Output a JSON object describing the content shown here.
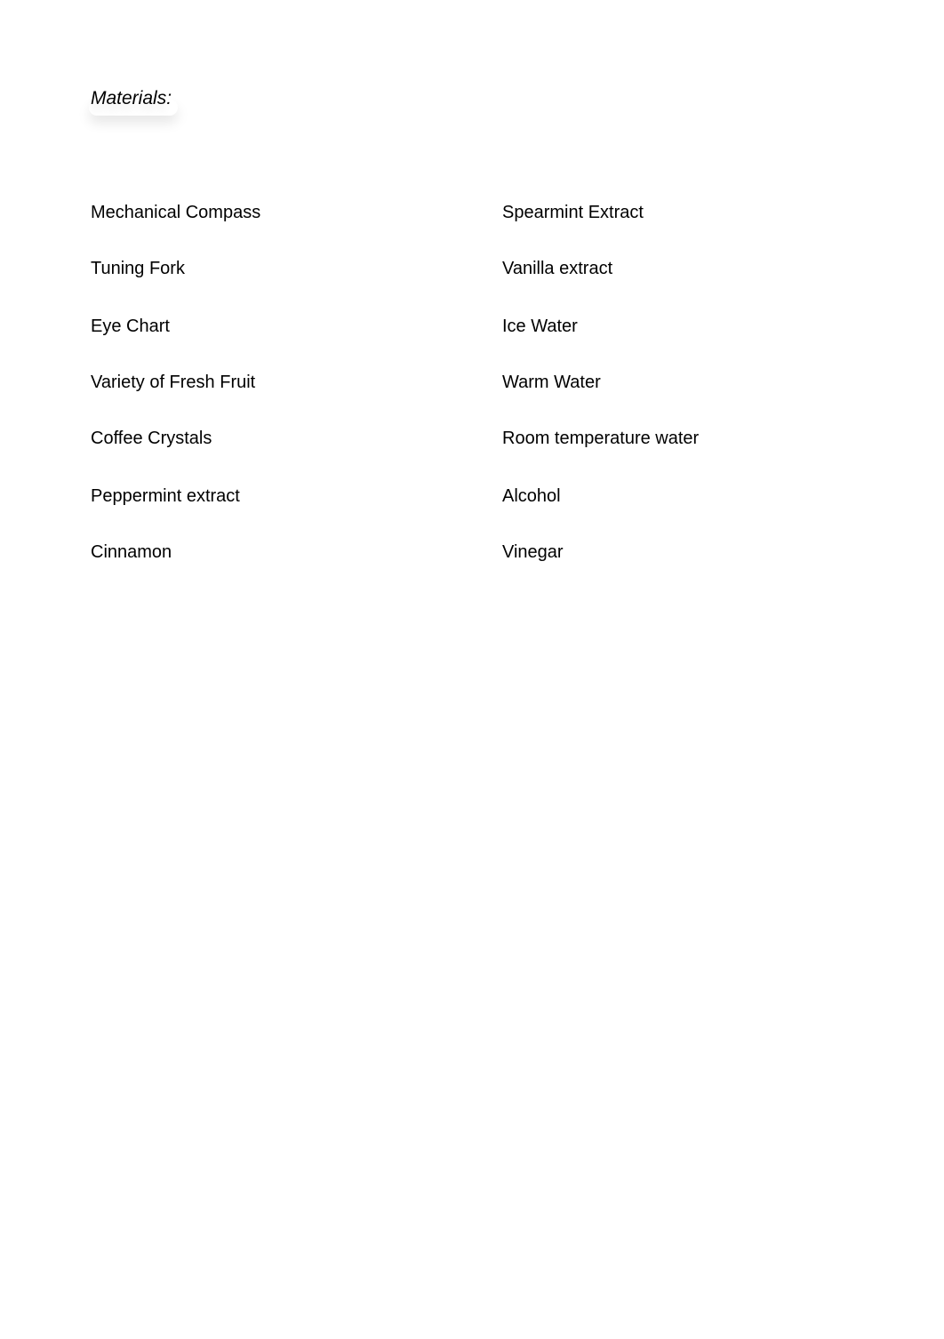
{
  "document": {
    "heading": "Materials:",
    "materials_left": [
      "Mechanical Compass",
      "Tuning Fork",
      "Eye Chart",
      "Variety of Fresh Fruit",
      "Coffee Crystals",
      "Peppermint extract",
      "Cinnamon"
    ],
    "materials_right": [
      "Spearmint Extract",
      "Vanilla extract",
      "Ice Water",
      "Warm Water",
      "Room temperature water",
      "Alcohol",
      "Vinegar"
    ]
  },
  "colors": {
    "background": "#ffffff",
    "text": "#000000"
  }
}
